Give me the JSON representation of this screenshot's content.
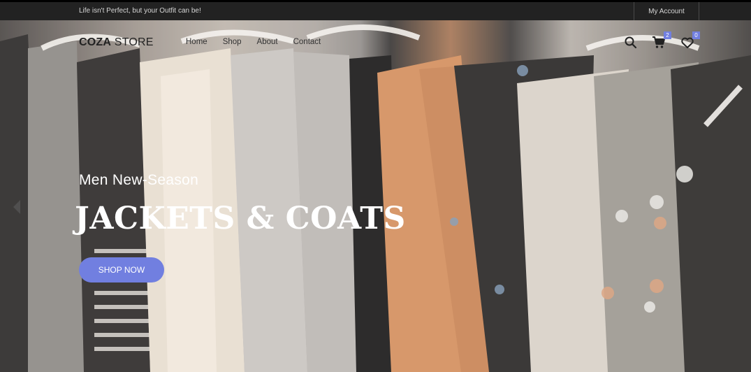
{
  "topbar": {
    "tagline": "Life isn't Perfect, but your Outfit can be!",
    "account_label": "My Account"
  },
  "header": {
    "logo_bold": "COZA",
    "logo_rest": " STORE",
    "menu": [
      "Home",
      "Shop",
      "About",
      "Contact"
    ],
    "cart_count": "2",
    "wishlist_count": "0"
  },
  "hero": {
    "kicker": "Men New-Season",
    "headline": "JACKETS & COATS",
    "cta_label": "SHOP NOW"
  },
  "colors": {
    "accent": "#717fe0",
    "topbar_bg": "#222222"
  },
  "icons": {
    "search": "search-icon",
    "cart": "cart-icon",
    "wishlist": "heart-icon",
    "prev": "chevron-left-icon"
  }
}
